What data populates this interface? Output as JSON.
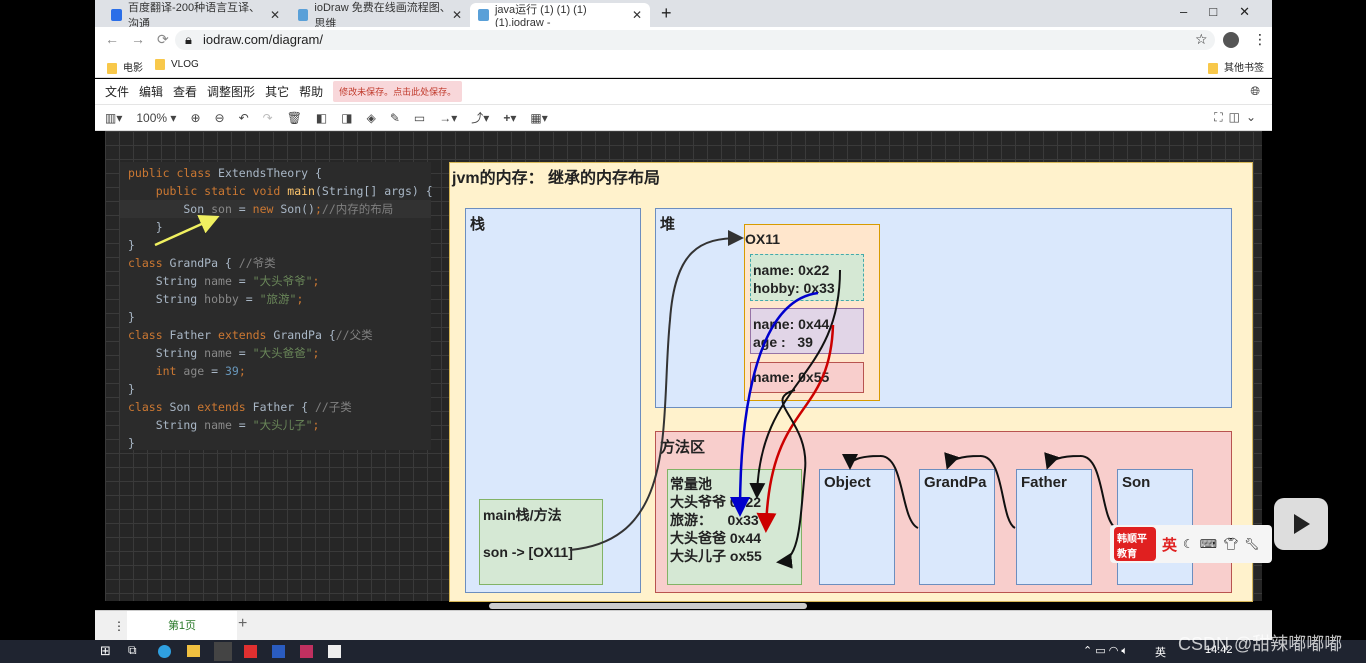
{
  "browser": {
    "tabs": [
      {
        "label": "百度翻译-200种语言互译、沟通",
        "icon": "translate-icon"
      },
      {
        "label": "ioDraw 免费在线画流程图、思维",
        "icon": "iodraw-icon"
      },
      {
        "label": "java运行 (1) (1) (1) (1).iodraw -",
        "icon": "iodraw-icon",
        "active": true
      }
    ],
    "url": "iodraw.com/diagram/",
    "bookmarks": [
      "电影",
      "VLOG"
    ],
    "other_bookmarks": "其他书签"
  },
  "menu": {
    "items": [
      "文件",
      "编辑",
      "查看",
      "调整图形",
      "其它",
      "帮助"
    ],
    "unsaved_notice": "修改未保存。点击此处保存。"
  },
  "toolbar": {
    "zoom": "100%"
  },
  "code": {
    "lines": [
      "public class ExtendsTheory {",
      "    public static void main(String[] args) {",
      "        Son son = new Son();//内存的布局",
      "    }",
      "}",
      "class GrandPa { //爷类",
      "    String name = \"大头爷爷\";",
      "    String hobby = \"旅游\";",
      "}",
      "class Father extends GrandPa {//父类",
      "    String name = \"大头爸爸\";",
      "    int age = 39;",
      "}",
      "class Son extends Father { //子类",
      "    String name = \"大头儿子\";",
      "}"
    ]
  },
  "diagram": {
    "title": "jvm的内存： 继承的内存布局",
    "stack": {
      "label": "栈",
      "main_frame": {
        "title": "main栈/方法",
        "ref": "son -> [OX11]"
      }
    },
    "heap": {
      "label": "堆",
      "object": {
        "address": "OX11",
        "grandpa_fields": "name: 0x22\nhobby: 0x33",
        "father_fields": "name: 0x44\nage :   39",
        "son_fields": "name: 0x55"
      }
    },
    "method_area": {
      "label": "方法区",
      "constant_pool": "常量池\n大头爷爷 0x22\n旅游：    0x33\n大头爸爸 0x44\n大头儿子 ox55",
      "classes": [
        "Object",
        "GrandPa",
        "Father",
        "Son"
      ]
    },
    "colors": {
      "blue_arrow": "#0000cc",
      "red_arrow": "#cc0000",
      "yellow_arrow": "#f0f060"
    }
  },
  "page_tab": "第1页",
  "ime": {
    "logo": "韩顺平教育",
    "lang": "英"
  },
  "taskbar": {
    "tray_lang": "英",
    "time": "14:42"
  },
  "watermark": "CSDN @甜辣嘟嘟嘟"
}
